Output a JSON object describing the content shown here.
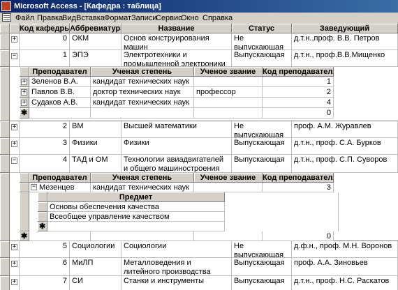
{
  "window": {
    "title": "Microsoft Access - [Кафедра : таблица]"
  },
  "menu": [
    "Файл",
    "Правка",
    "Вид",
    "Вставка",
    "Формат",
    "Записи",
    "Сервис",
    "Окно",
    "Справка"
  ],
  "main_columns": [
    "Код кафедры",
    "Аббревиатура",
    "Название",
    "Статус",
    "Заведующий"
  ],
  "rows": [
    {
      "code": "0",
      "abbr": "ОКМ",
      "name": "Основ конструирования машин",
      "status": "Не выпускающая",
      "head": "д.т.н.,проф. В.В. Петров",
      "expanded": false
    },
    {
      "code": "1",
      "abbr": "ЭПЭ",
      "name": "Электротехники и промышленной электроники",
      "status": "Выпускающая",
      "head": "д.т.н., проф.В.В.Мищенко",
      "expanded": true
    },
    {
      "code": "2",
      "abbr": "ВМ",
      "name": "Высшей математики",
      "status": "Не выпускающая",
      "head": "проф. А.М. Журавлев",
      "expanded": false
    },
    {
      "code": "3",
      "abbr": "Физики",
      "name": "Физики",
      "status": "Выпускающая",
      "head": "д.т.н., проф. С.А. Бурков",
      "expanded": false
    },
    {
      "code": "4",
      "abbr": "ТАД и ОМ",
      "name": "Технологии авиадвигателей и общего машиностроения",
      "status": "Выпускающая",
      "head": "д.т.н., проф. С.П. Суворов",
      "expanded": true
    },
    {
      "code": "5",
      "abbr": "Социологии",
      "name": "Социологии",
      "status": "Не выпускающая",
      "head": "д.ф.н., проф. М.Н. Воронов",
      "expanded": false
    },
    {
      "code": "6",
      "abbr": "МиЛП",
      "name": "Металловедения и литейного производства",
      "status": "Выпускающая",
      "head": "проф. А.А. Зиновьев",
      "expanded": false
    },
    {
      "code": "7",
      "abbr": "СИ",
      "name": "Станки и инструменты",
      "status": "Выпускающая",
      "head": "д.т.н., проф. Н.С. Раскатов",
      "expanded": false
    }
  ],
  "sub1": {
    "columns": [
      "Преподавател",
      "Ученая степень",
      "Ученое звание",
      "Код преподавателя"
    ],
    "rows": [
      {
        "name": "Зеленов В.А.",
        "degree": "кандидат технических наук",
        "title": "",
        "code": "1"
      },
      {
        "name": "Павлов В.В.",
        "degree": "доктор технических наук",
        "title": "профессор",
        "code": "2"
      },
      {
        "name": "Судаков А.В.",
        "degree": "кандидат технических наук",
        "title": "",
        "code": "4"
      }
    ],
    "new_code": "0"
  },
  "sub2": {
    "columns": [
      "Преподавател",
      "Ученая степень",
      "Ученое звание",
      "Код преподавателя"
    ],
    "rows": [
      {
        "name": "Мезенцев А.С.",
        "degree": "кандидат технических наук",
        "title": "",
        "code": "3"
      }
    ],
    "new_code": "0",
    "nested": {
      "column": "Предмет",
      "rows": [
        "Основы обеспечения качества",
        "Всеобщее управление качеством"
      ]
    }
  },
  "glyphs": {
    "plus": "+",
    "minus": "−",
    "star": "✱"
  }
}
